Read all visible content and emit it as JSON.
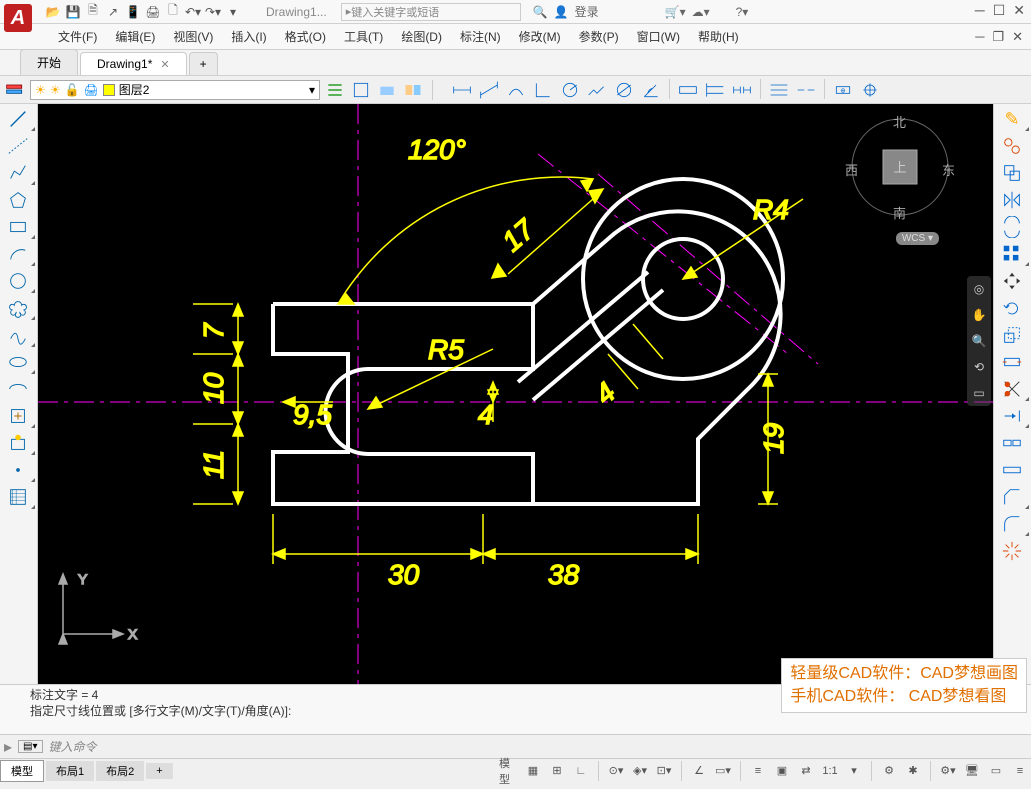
{
  "app": {
    "logo": "A",
    "title": "Drawing1..."
  },
  "search": {
    "placeholder": "键入关键字或短语"
  },
  "login": {
    "label": "登录"
  },
  "menus": {
    "file": "文件(F)",
    "edit": "编辑(E)",
    "view": "视图(V)",
    "insert": "插入(I)",
    "format": "格式(O)",
    "tools": "工具(T)",
    "draw": "绘图(D)",
    "annotate": "标注(N)",
    "modify": "修改(M)",
    "params": "参数(P)",
    "window": "窗口(W)",
    "help": "帮助(H)"
  },
  "tabs": {
    "start": "开始",
    "drawing": "Drawing1*"
  },
  "layer": {
    "name": "图层2"
  },
  "drawing": {
    "dims": {
      "angle": "120°",
      "d17": "17",
      "r4": "R4",
      "d7": "7",
      "r5": "R5",
      "d10": "10",
      "d95": "9,5",
      "d4a": "4",
      "d4b": "4",
      "d11": "11",
      "d19": "19",
      "d30": "30",
      "d38": "38"
    },
    "axes": {
      "x": "X",
      "y": "Y"
    },
    "compass": {
      "n": "北",
      "s": "南",
      "e": "东",
      "w": "西",
      "top": "上"
    },
    "wcs": "WCS"
  },
  "cmd": {
    "line1": "标注文字 = 4",
    "line2": "指定尺寸线位置或 [多行文字(M)/文字(T)/角度(A)]:",
    "placeholder": "键入命令"
  },
  "status": {
    "model": "模型",
    "layout1": "布局1",
    "layout2": "布局2",
    "model_btn": "模型",
    "scale": "1:1"
  },
  "watermark": {
    "line1": "轻量级CAD软件：CAD梦想画图",
    "line2": "手机CAD软件： CAD梦想看图"
  }
}
